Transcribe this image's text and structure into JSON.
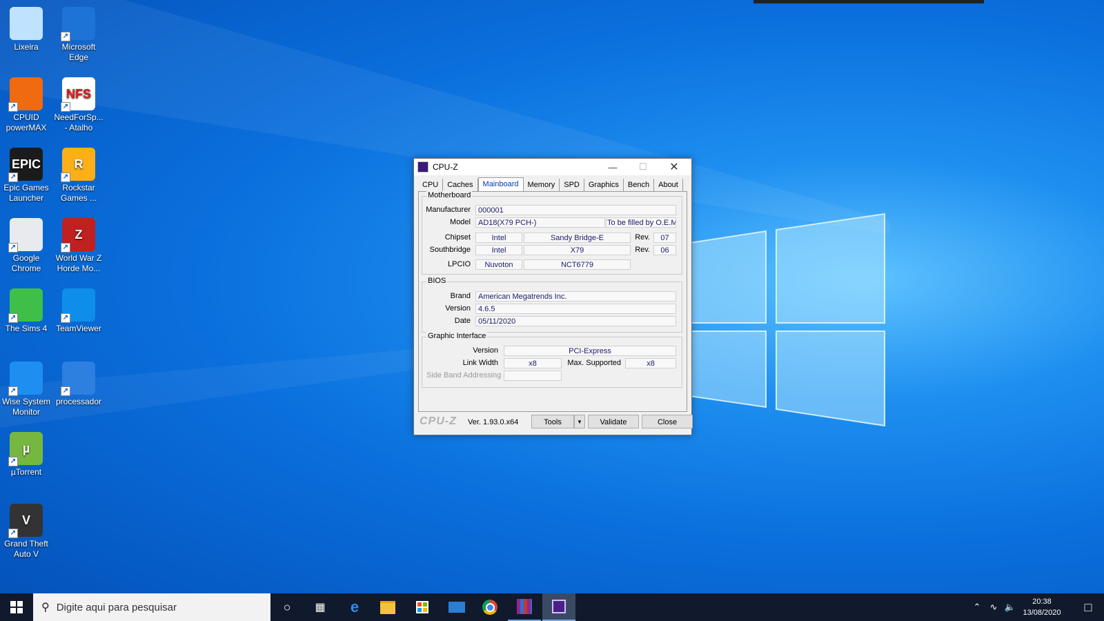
{
  "desktop": {
    "icons": [
      {
        "label": "Lixeira",
        "icon": "recycle-bin-icon",
        "color": "#bfe3ff"
      },
      {
        "label": "Microsoft Edge",
        "icon": "edge-icon",
        "color": "#1e73d6"
      },
      {
        "label": "CPUID powerMAX",
        "icon": "flame-icon",
        "color": "#f06a10"
      },
      {
        "label": "NeedForSp... - Atalho",
        "icon": "nfs-icon",
        "color": "#ffffff"
      },
      {
        "label": "Epic Games Launcher",
        "icon": "epic-games-icon",
        "color": "#1b1b1b"
      },
      {
        "label": "Rockstar Games ...",
        "icon": "rockstar-icon",
        "color": "#fcaf17"
      },
      {
        "label": "Google Chrome",
        "icon": "chrome-icon",
        "color": "#e8eaed"
      },
      {
        "label": "World War Z Horde Mo...",
        "icon": "wwz-icon",
        "color": "#c0201f"
      },
      {
        "label": "The Sims 4",
        "icon": "sims-icon",
        "color": "#3fbf4a"
      },
      {
        "label": "TeamViewer",
        "icon": "teamviewer-icon",
        "color": "#0e8ee9"
      },
      {
        "label": "Wise System Monitor",
        "icon": "wise-monitor-icon",
        "color": "#1e8ff0"
      },
      {
        "label": "processador",
        "icon": "processor-shortcut-icon",
        "color": "#2d7fe0"
      },
      {
        "label": "µTorrent",
        "icon": "utorrent-icon",
        "color": "#76b83f"
      },
      {
        "label": "Grand Theft Auto V",
        "icon": "gta-icon",
        "color": "#333333"
      }
    ],
    "text": {
      "nfs": "NFS",
      "epic": "EPIC",
      "rockstar": "R",
      "wwz": "Z",
      "gta": "V",
      "utorrent": "µ"
    }
  },
  "window": {
    "title": "CPU-Z",
    "tabs": [
      "CPU",
      "Caches",
      "Mainboard",
      "Memory",
      "SPD",
      "Graphics",
      "Bench",
      "About"
    ],
    "active_tab": "Mainboard",
    "motherboard": {
      "legend": "Motherboard",
      "manufacturer_label": "Manufacturer",
      "manufacturer": "000001",
      "model_label": "Model",
      "model": "AD18(X79 PCH-)",
      "model_extra": "To be filled by O.E.M.",
      "chipset_label": "Chipset",
      "chipset_vendor": "Intel",
      "chipset_name": "Sandy Bridge-E",
      "rev_label": "Rev.",
      "chipset_rev": "07",
      "southbridge_label": "Southbridge",
      "southbridge_vendor": "Intel",
      "southbridge_name": "X79",
      "southbridge_rev": "06",
      "lpcio_label": "LPCIO",
      "lpcio_vendor": "Nuvoton",
      "lpcio_name": "NCT6779"
    },
    "bios": {
      "legend": "BIOS",
      "brand_label": "Brand",
      "brand": "American Megatrends Inc.",
      "version_label": "Version",
      "version": "4.6.5",
      "date_label": "Date",
      "date": "05/11/2020"
    },
    "graphic": {
      "legend": "Graphic Interface",
      "version_label": "Version",
      "version": "PCI-Express",
      "link_width_label": "Link Width",
      "link_width": "x8",
      "max_supported_label": "Max. Supported",
      "max_supported": "x8",
      "sideband_label": "Side Band Addressing",
      "sideband": ""
    },
    "footer": {
      "logo": "CPU-Z",
      "version": "Ver. 1.93.0.x64",
      "tools": "Tools",
      "validate": "Validate",
      "close": "Close"
    }
  },
  "taskbar": {
    "search_placeholder": "Digite aqui para pesquisar",
    "time": "20:38",
    "date": "13/08/2020"
  }
}
